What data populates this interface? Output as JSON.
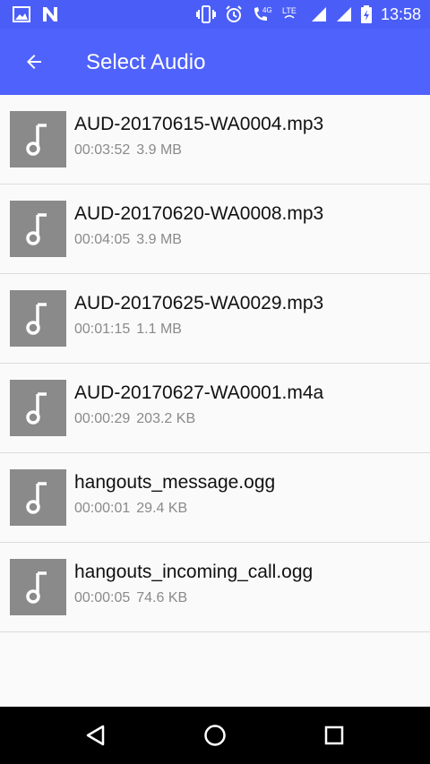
{
  "status_bar": {
    "time": "13:58",
    "icons": [
      "image-icon",
      "n-logo-icon",
      "vibrate-icon",
      "alarm-icon",
      "wifi-calling-4g-icon",
      "lte-icon",
      "signal-icon",
      "signal-icon",
      "battery-charging-icon"
    ],
    "lte_label": "LTE",
    "four_g_label": "4G"
  },
  "app_bar": {
    "title": "Select Audio",
    "back_icon": "arrow-back-icon",
    "accent_color": "#4f62fb"
  },
  "audio_files": [
    {
      "name": "AUD-20170615-WA0004.mp3",
      "duration": "00:03:52",
      "size": "3.9 MB"
    },
    {
      "name": "AUD-20170620-WA0008.mp3",
      "duration": "00:04:05",
      "size": "3.9 MB"
    },
    {
      "name": "AUD-20170625-WA0029.mp3",
      "duration": "00:01:15",
      "size": "1.1 MB"
    },
    {
      "name": "AUD-20170627-WA0001.m4a",
      "duration": "00:00:29",
      "size": "203.2 KB"
    },
    {
      "name": "hangouts_message.ogg",
      "duration": "00:00:01",
      "size": "29.4 KB"
    },
    {
      "name": "hangouts_incoming_call.ogg",
      "duration": "00:00:05",
      "size": "74.6 KB"
    }
  ],
  "nav_bar": {
    "buttons": [
      "back-triangle-icon",
      "home-circle-icon",
      "recents-square-icon"
    ]
  }
}
